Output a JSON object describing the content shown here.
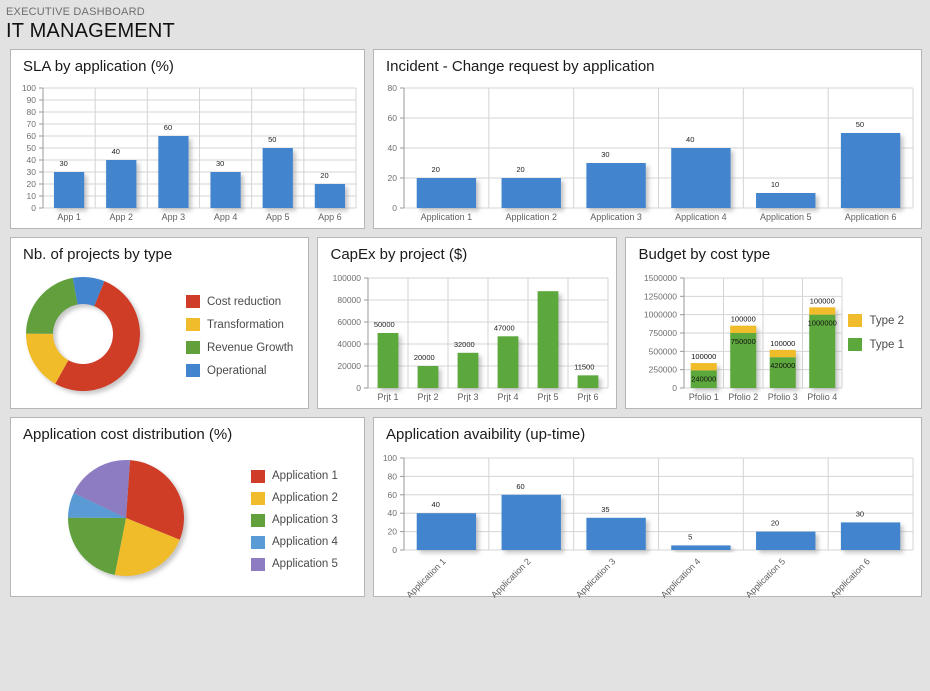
{
  "header": {
    "eyebrow": "EXECUTIVE DASHBOARD",
    "title": "IT MANAGEMENT"
  },
  "colors": {
    "blue": "#4285ce",
    "green": "#5da83c",
    "yellow": "#f0bc2b",
    "red": "#cf3c28",
    "purple": "#8e7cc3",
    "light_blue": "#5a9bd5",
    "panel_bg": "#ffffff",
    "page_bg": "#e2e2e2",
    "border": "#b6b6b6"
  },
  "panels": {
    "sla": {
      "title": "SLA by application (%)"
    },
    "incident": {
      "title": "Incident - Change request by application"
    },
    "projects": {
      "title": "Nb. of projects by type"
    },
    "capex": {
      "title": "CapEx by project ($)"
    },
    "budget": {
      "title": "Budget by cost type"
    },
    "appcost": {
      "title": "Application cost distribution (%)"
    },
    "availability": {
      "title": "Application avaibility (up-time)"
    }
  },
  "chart_data": [
    {
      "id": "sla",
      "type": "bar",
      "title": "SLA by application (%)",
      "categories": [
        "App 1",
        "App 2",
        "App 3",
        "App 4",
        "App 5",
        "App 6"
      ],
      "values": [
        30,
        40,
        60,
        30,
        50,
        20
      ],
      "data_labels": [
        "30",
        "40",
        "60",
        "30",
        "50",
        "20"
      ],
      "yticks": [
        0,
        10,
        20,
        30,
        40,
        50,
        60,
        70,
        80,
        90,
        100
      ],
      "ylim": [
        0,
        100
      ],
      "xlabel": "",
      "ylabel": "",
      "grid": true,
      "legend": "none",
      "color": "#4285ce"
    },
    {
      "id": "incident",
      "type": "bar",
      "title": "Incident - Change request by application",
      "categories": [
        "Application 1",
        "Application 2",
        "Application 3",
        "Application 4",
        "Application 5",
        "Application 6"
      ],
      "values": [
        20,
        20,
        30,
        40,
        10,
        50
      ],
      "data_labels": [
        "20",
        "20",
        "30",
        "40",
        "10",
        "50"
      ],
      "yticks": [
        0,
        20,
        40,
        60,
        80
      ],
      "ylim": [
        0,
        80
      ],
      "xlabel": "",
      "ylabel": "",
      "grid": true,
      "legend": "none",
      "color": "#4285ce"
    },
    {
      "id": "projects",
      "type": "pie",
      "subtype": "donut",
      "title": "Nb. of projects by type",
      "categories": [
        "Cost reduction",
        "Transformation",
        "Revenue Growth",
        "Operational"
      ],
      "values": [
        52,
        17,
        22,
        9
      ],
      "colors": [
        "#cf3c28",
        "#f0bc2b",
        "#62a03c",
        "#4285ce"
      ],
      "legend": "right"
    },
    {
      "id": "capex",
      "type": "bar",
      "title": "CapEx by project ($)",
      "categories": [
        "Prjt 1",
        "Prjt 2",
        "Prjt 3",
        "Prjt 4",
        "Prjt 5",
        "Prjt 6"
      ],
      "values": [
        50000,
        20000,
        32000,
        47000,
        88000,
        11500
      ],
      "data_labels": [
        "50000",
        "20000",
        "32000",
        "47000",
        "",
        "11500"
      ],
      "yticks": [
        0,
        20000,
        40000,
        60000,
        80000,
        100000
      ],
      "ylim": [
        0,
        100000
      ],
      "xlabel": "",
      "ylabel": "",
      "grid": true,
      "legend": "none",
      "color": "#5da83c"
    },
    {
      "id": "budget",
      "type": "bar",
      "subtype": "stacked",
      "title": "Budget by cost type",
      "categories": [
        "Pfolio 1",
        "Pfolio 2",
        "Pfolio 3",
        "Pfolio 4"
      ],
      "series": [
        {
          "name": "Type 1",
          "values": [
            240000,
            750000,
            420000,
            1000000
          ],
          "color": "#5da83c",
          "data_labels": [
            "240000",
            "750000",
            "420000",
            "1000000"
          ]
        },
        {
          "name": "Type 2",
          "values": [
            100000,
            100000,
            100000,
            100000
          ],
          "color": "#f0bc2b",
          "data_labels": [
            "100000",
            "100000",
            "100000",
            "100000"
          ]
        }
      ],
      "yticks": [
        0,
        250000,
        500000,
        750000,
        1000000,
        1250000,
        1500000
      ],
      "ylim": [
        0,
        1500000
      ],
      "xlabel": "",
      "ylabel": "",
      "grid": true,
      "legend": "right",
      "legend_order": [
        "Type 2",
        "Type 1"
      ]
    },
    {
      "id": "appcost",
      "type": "pie",
      "title": "Application cost distribution (%)",
      "categories": [
        "Application 1",
        "Application 2",
        "Application 3",
        "Application 4",
        "Application 5"
      ],
      "values": [
        30,
        22,
        22,
        7,
        19
      ],
      "colors": [
        "#cf3c28",
        "#f0bc2b",
        "#62a03c",
        "#5a9bd5",
        "#8e7cc3"
      ],
      "legend": "right"
    },
    {
      "id": "availability",
      "type": "bar",
      "title": "Application avaibility (up-time)",
      "categories": [
        "Application 1",
        "Application 2",
        "Application 3",
        "Application 4",
        "Application 5",
        "Application 6"
      ],
      "values": [
        40,
        60,
        35,
        5,
        20,
        30
      ],
      "data_labels": [
        "40",
        "60",
        "35",
        "5",
        "20",
        "30"
      ],
      "yticks": [
        0,
        20,
        40,
        60,
        80,
        100
      ],
      "ylim": [
        0,
        100
      ],
      "xlabel": "",
      "ylabel": "",
      "grid": true,
      "legend": "none",
      "xtick_rotation": -45,
      "color": "#4285ce"
    }
  ]
}
